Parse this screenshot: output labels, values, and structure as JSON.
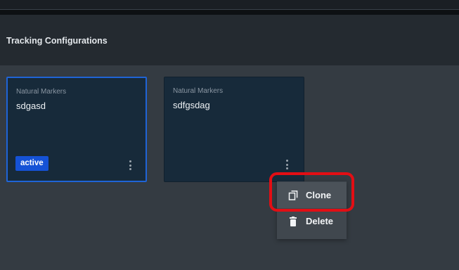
{
  "header": {
    "title": "Tracking Configurations"
  },
  "cards": [
    {
      "type": "Natural Markers",
      "name": "sdgasd",
      "badge": "active"
    },
    {
      "type": "Natural Markers",
      "name": "sdfgsdag"
    }
  ],
  "context_menu": {
    "items": [
      {
        "label": "Clone",
        "icon": "clone-icon"
      },
      {
        "label": "Delete",
        "icon": "trash-icon"
      }
    ]
  },
  "colors": {
    "accent": "#1f64d6",
    "badge": "#1552d6",
    "highlight": "#e30e14",
    "card_bg": "#172a3a"
  }
}
